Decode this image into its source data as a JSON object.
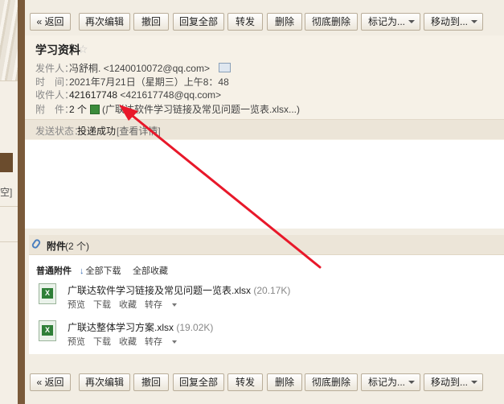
{
  "toolbar": {
    "back": "« 返回",
    "reedit": "再次编辑",
    "recall": "撤回",
    "reply_all": "回复全部",
    "forward": "转发",
    "delete": "删除",
    "delete_perm": "彻底删除",
    "mark_as": "标记为...",
    "move_to": "移动到..."
  },
  "mail": {
    "subject": "学习资料",
    "sender_label": "发件人：",
    "sender_name": "冯舒桐.",
    "sender_email": "<1240010072@qq.com>",
    "time_label": "时　间：",
    "time_value": "2021年7月21日（星期三）上午8：48",
    "recipient_label": "收件人：",
    "recipient_name": "421617748",
    "recipient_email": "<421617748@qq.com>",
    "attach_label": "附　件：",
    "attach_count": "2 个",
    "attach_preview": "(广联达软件学习链接及常见问题一览表.xlsx...)",
    "status_label": "发送状态：",
    "status_value": "投递成功",
    "status_link": "[查看详情]"
  },
  "attachments": {
    "title": "附件",
    "count": "(2 个)",
    "section": "普通附件",
    "download_all": "全部下载",
    "favorite_all": "全部收藏",
    "items": [
      {
        "name": "广联达软件学习链接及常见问题一览表.xlsx",
        "size": "(20.17K)",
        "actions": [
          "预览",
          "下载",
          "收藏",
          "转存"
        ]
      },
      {
        "name": "广联达整体学习方案.xlsx",
        "size": "(19.02K)",
        "actions": [
          "预览",
          "下载",
          "收藏",
          "转存"
        ]
      }
    ]
  },
  "left_edge_text": "空]",
  "colors": {
    "frame": "#7a5a3a",
    "background": "#f2ede3",
    "sender_green": "#2e8b2e",
    "annotation_arrow": "#e8182a"
  }
}
